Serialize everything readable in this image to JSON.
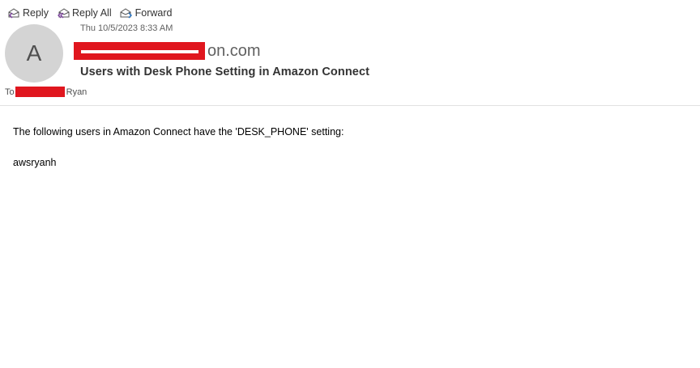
{
  "toolbar": {
    "reply_label": "Reply",
    "reply_all_label": "Reply All",
    "forward_label": "Forward"
  },
  "header": {
    "avatar_initial": "A",
    "timestamp": "Thu 10/5/2023 8:33 AM",
    "sender_visible_suffix": "on.com",
    "subject": "Users with Desk Phone Setting in Amazon Connect",
    "to_prefix": "To",
    "to_name_visible": "Ryan"
  },
  "message": {
    "line1": "The following users in Amazon Connect have the 'DESK_PHONE' setting:",
    "line2": "awsryanh"
  },
  "colors": {
    "redaction": "#e0161e",
    "icon_accent": "#7a3e9d",
    "avatar_bg": "#d4d4d4"
  }
}
